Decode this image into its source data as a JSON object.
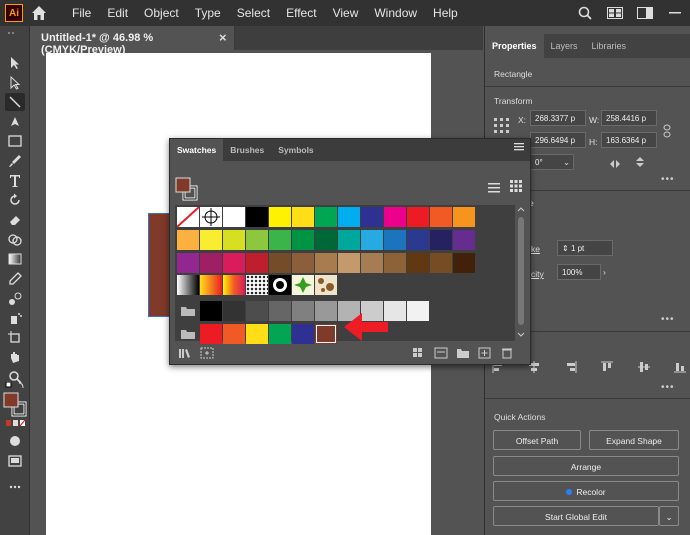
{
  "app": {
    "logo_text": "Ai"
  },
  "menu": [
    "File",
    "Edit",
    "Object",
    "Type",
    "Select",
    "Effect",
    "View",
    "Window",
    "Help"
  ],
  "document_tab": {
    "title": "Untitled-1* @ 46.98 % (CMYK/Preview)",
    "close": "×"
  },
  "right_panel": {
    "tabs": [
      "Properties",
      "Layers",
      "Libraries"
    ],
    "selection_type": "Rectangle",
    "transform_label": "Transform",
    "x_label": "X:",
    "x_value": "268.3377 p",
    "w_label": "W:",
    "w_value": "258.4416 p",
    "y_label": "Y:",
    "y_value": "296.6494 p",
    "h_label": "H:",
    "h_value": "163.6364 p",
    "rotation_value": "0°",
    "appearance_label": "e",
    "stroke_label": "ke",
    "stroke_value": "1 pt",
    "opacity_label": "city",
    "opacity_value": "100%",
    "quick_actions_label": "Quick Actions",
    "offset_path": "Offset Path",
    "expand_shape": "Expand Shape",
    "arrange": "Arrange",
    "recolor": "Recolor",
    "start_global_edit": "Start Global Edit",
    "more": "•••"
  },
  "swatches_panel": {
    "tabs": [
      "Swatches",
      "Brushes",
      "Symbols"
    ],
    "fill_color": "#7f3a2a",
    "rows": [
      [
        "none",
        "registration",
        "#ffffff",
        "#000000",
        "#fff200",
        "#ffde17",
        "#00a651",
        "#00aeef",
        "#2e3192",
        "#ec008c",
        "#ed1c24",
        "#f15a24",
        "#f7941d"
      ],
      [
        "#fbb040",
        "#f9ed32",
        "#d7df23",
        "#8dc63f",
        "#39b54a",
        "#009444",
        "#006838",
        "#00a79d",
        "#27aae1",
        "#1c75bc",
        "#2b3990",
        "#262262",
        "#662d91"
      ],
      [
        "#92278f",
        "#9e1f63",
        "#da1c5c",
        "#be1e2d",
        "#754c29",
        "#8b5e3c",
        "#a97c50",
        "#c49a6c",
        "#a67c52",
        "#8c6239",
        "#603913",
        "#754c24",
        "#42210b"
      ],
      [
        "gradient-bw",
        "gradient-orange",
        "gradient-yellow",
        "pattern-dots",
        "pattern-black",
        "pattern-green",
        "pattern-brown"
      ],
      [
        "folder",
        "#000000",
        "#333333",
        "#4d4d4d",
        "#666666",
        "#808080",
        "#999999",
        "#b3b3b3",
        "#cccccc",
        "#e6e6e6",
        "#f2f2f2"
      ],
      [
        "folder",
        "#ed1c24",
        "#f15a24",
        "#ffde17",
        "#00a651",
        "#2e3192",
        "#7f3a2a"
      ]
    ]
  }
}
